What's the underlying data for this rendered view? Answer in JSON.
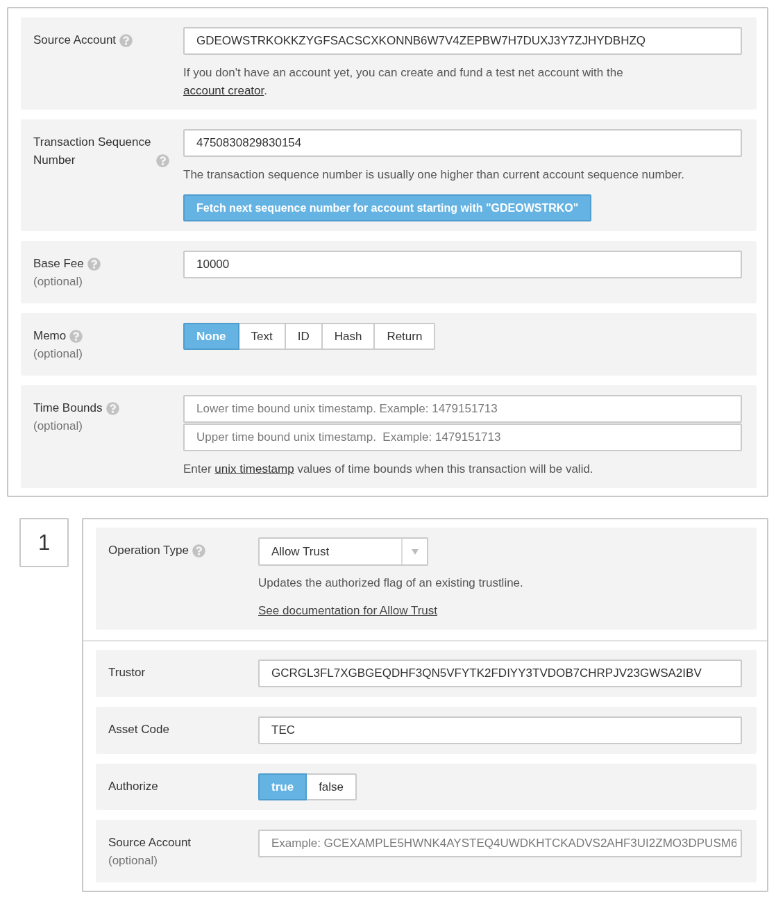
{
  "transaction": {
    "rows": [
      {
        "kind": "text",
        "label": "Source Account",
        "help": true,
        "value": "GDEOWSTRKOKKZYGFSACSCXKONNB6W7V4ZEPBW7H7DUXJ3Y7ZJHYDBHZQ",
        "note": [
          {
            "text": "If you don't have an account yet, you can create and fund a test net account with the "
          },
          {
            "text": "account creator",
            "link": true
          },
          {
            "text": "."
          }
        ]
      },
      {
        "kind": "text",
        "label": "Transaction Sequence Number",
        "help": true,
        "value": "4750830829830154",
        "note": [
          {
            "text": "The transaction sequence number is usually one higher than current account sequence number."
          }
        ],
        "button": "Fetch next sequence number for account starting with \"GDEOWSTRKO\""
      },
      {
        "kind": "text",
        "label": "Base Fee",
        "sublabel": "(optional)",
        "help": true,
        "value": "10000"
      },
      {
        "kind": "choice",
        "label": "Memo",
        "sublabel": "(optional)",
        "help": true,
        "options": [
          {
            "label": "None",
            "selected": true
          },
          {
            "label": "Text",
            "selected": false
          },
          {
            "label": "ID",
            "selected": false
          },
          {
            "label": "Hash",
            "selected": false
          },
          {
            "label": "Return",
            "selected": false
          }
        ]
      },
      {
        "kind": "stack",
        "label": "Time Bounds",
        "sublabel": "(optional)",
        "help": true,
        "fields": [
          {
            "placeholder": "Lower time bound unix timestamp. Example: 1479151713"
          },
          {
            "placeholder": "Upper time bound unix timestamp.  Example: 1479151713"
          }
        ],
        "note": [
          {
            "text": "Enter "
          },
          {
            "text": "unix timestamp",
            "link": true
          },
          {
            "text": " values of time bounds when this transaction will be valid."
          }
        ]
      }
    ]
  },
  "operation": {
    "number": "1",
    "type": {
      "label": "Operation Type",
      "help": true,
      "value": "Allow Trust",
      "description": "Updates the authorized flag of an existing trustline.",
      "doc_link": "See documentation for Allow Trust"
    },
    "fields": [
      {
        "kind": "text",
        "label": "Trustor",
        "value": "GCRGL3FL7XGBGEQDHF3QN5VFYTK2FDIYY3TVDOB7CHRPJV23GWSA2IBV"
      },
      {
        "kind": "text",
        "label": "Asset Code",
        "value": "TEC"
      },
      {
        "kind": "choice",
        "label": "Authorize",
        "options": [
          {
            "label": "true",
            "selected": true
          },
          {
            "label": "false",
            "selected": false
          }
        ]
      },
      {
        "kind": "text",
        "label": "Source Account",
        "sublabel": "(optional)",
        "placeholder": "Example: GCEXAMPLE5HWNK4AYSTEQ4UWDKHTCKADVS2AHF3UI2ZMO3DPUSM6"
      }
    ]
  }
}
